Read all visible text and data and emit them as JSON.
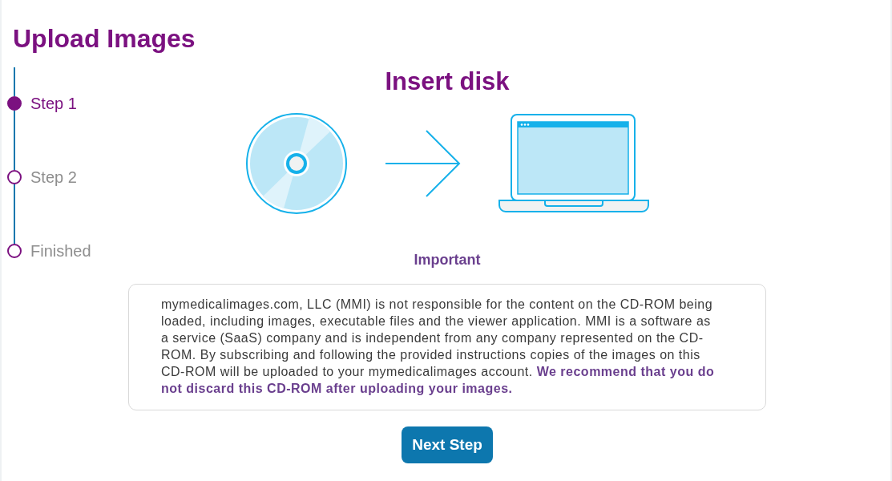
{
  "page": {
    "title": "Upload Images"
  },
  "steps": [
    {
      "label": "Step 1",
      "selected": true
    },
    {
      "label": "Step 2",
      "selected": false
    },
    {
      "label": "Finished",
      "selected": false
    }
  ],
  "panel": {
    "heading": "Insert disk"
  },
  "notice": {
    "heading": "Important",
    "text": "mymedicalimages.com, LLC (MMI) is not responsible for the content on the CD-ROM being loaded, including images, executable files and the viewer application. MMI is a software as a service (SaaS) company and is independent from any company represented on the CD-ROM. By subscribing and following the provided instructions copies of the images on this CD-ROM will be uploaded to your mymedicalimages account. **We recommend that you do not discard this CD-ROM after uploading your images.**"
  },
  "buttons": [
    {
      "label": "Next Step"
    }
  ]
}
